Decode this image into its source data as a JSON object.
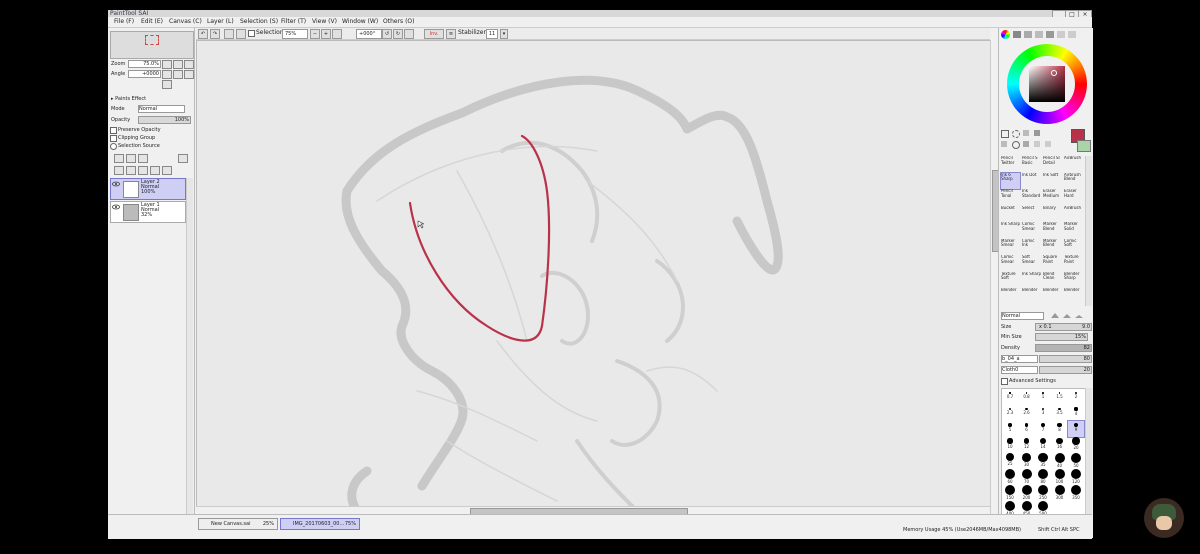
{
  "app": {
    "title": "PaintTool SAI",
    "window_controls": [
      "_",
      "□",
      "×"
    ]
  },
  "menu": [
    {
      "label": "File (F)"
    },
    {
      "label": "Edit (E)"
    },
    {
      "label": "Canvas (C)"
    },
    {
      "label": "Layer (L)"
    },
    {
      "label": "Selection (S)"
    },
    {
      "label": "Filter (T)"
    },
    {
      "label": "View (V)"
    },
    {
      "label": "Window (W)"
    },
    {
      "label": "Others (O)"
    }
  ],
  "toolbar": {
    "selection_label": "Selection",
    "zoom_value": "75%",
    "rotation_value": "+000°",
    "invert_label": "Inv.",
    "stabilizer_label": "Stabilizer",
    "stabilizer_value": "11"
  },
  "navigator": {
    "zoom_label": "Zoom",
    "zoom_value": "75.0%",
    "angle_label": "Angle",
    "angle_value": "+0000"
  },
  "layer_panel": {
    "paints_effect_label": "Paints Effect",
    "mode_label": "Mode",
    "mode_value": "Normal",
    "opacity_label": "Opacity",
    "opacity_value": "100%",
    "preserve_opacity_label": "Preserve Opacity",
    "clipping_group_label": "Clipping Group",
    "selection_source_label": "Selection Source",
    "layers": [
      {
        "name": "Layer 2",
        "mode": "Normal",
        "opacity": "100%",
        "selected": true
      },
      {
        "name": "Layer 1",
        "mode": "Normal",
        "opacity": "32%",
        "selected": false
      }
    ]
  },
  "color": {
    "current_primary": "#b8334a",
    "current_secondary": "#a8d4a8",
    "stroke_color": "#b8334a"
  },
  "tools": [
    {
      "label": "Pencil Twitter"
    },
    {
      "label": "Pencil S Basic"
    },
    {
      "label": "Pencil Sl Detail"
    },
    {
      "label": "AirBrush"
    },
    {
      "label": "Ink 6 Sharp",
      "selected": true
    },
    {
      "label": "Ink Dot"
    },
    {
      "label": "Ink Soft"
    },
    {
      "label": "Airbrush Blend"
    },
    {
      "label": "Pencil Tonal"
    },
    {
      "label": "Ink Standard"
    },
    {
      "label": "Eraser Medium"
    },
    {
      "label": "Eraser Hard"
    },
    {
      "label": "Bucket"
    },
    {
      "label": "Select"
    },
    {
      "label": "Binary"
    },
    {
      "label": "AirBrush"
    },
    {
      "label": "Ink Sharp"
    },
    {
      "label": "Comic Smear"
    },
    {
      "label": "Marker Blend"
    },
    {
      "label": "Marker Solid"
    },
    {
      "label": "Marker Smear"
    },
    {
      "label": "Comic Ink"
    },
    {
      "label": "Marker Blend"
    },
    {
      "label": "Comic Soft"
    },
    {
      "label": "Comic Smear"
    },
    {
      "label": "Soft Smear"
    },
    {
      "label": "Square Paint"
    },
    {
      "label": "Texture Paint"
    },
    {
      "label": "Texture Soft"
    },
    {
      "label": "Ink Sharp"
    },
    {
      "label": "Blend Clean"
    },
    {
      "label": "Blender Sharp"
    },
    {
      "label": "Blender"
    },
    {
      "label": "Blender"
    },
    {
      "label": "Blender"
    },
    {
      "label": "Blender"
    }
  ],
  "brush_settings": {
    "blend_mode": "Normal",
    "size_label": "Size",
    "size_multiplier": "x 0.1",
    "size_value": "9.0",
    "min_size_label": "Min Size",
    "min_size_value": "15%",
    "density_label": "Density",
    "density_value": "82",
    "texture_name": "b_04_a",
    "texture_value": "80",
    "shape_name": "Cloth0",
    "shape_value": "20",
    "advanced_label": "Advanced Settings"
  },
  "brush_sizes": [
    "0.7",
    "0.8",
    "1",
    "1.5",
    "2",
    "2.3",
    "2.6",
    "3",
    "3.5",
    "4",
    "5",
    "6",
    "7",
    "8",
    "9",
    "10",
    "12",
    "14",
    "16",
    "20",
    "25",
    "30",
    "35",
    "40",
    "50",
    "60",
    "70",
    "80",
    "100",
    "120",
    "150",
    "200",
    "250",
    "300",
    "350",
    "400",
    "450",
    "500"
  ],
  "selected_brush_size": "9",
  "documents": [
    {
      "name": "New Canvas.sai",
      "zoom": "25%",
      "active": false
    },
    {
      "name": "IMG_20170603_00...",
      "zoom": "75%",
      "active": true
    }
  ],
  "status": {
    "memory": "Memory Usage 45% (Use2046MB/Max4098MB)",
    "keys": "Shift Ctrl Alt SPC"
  }
}
